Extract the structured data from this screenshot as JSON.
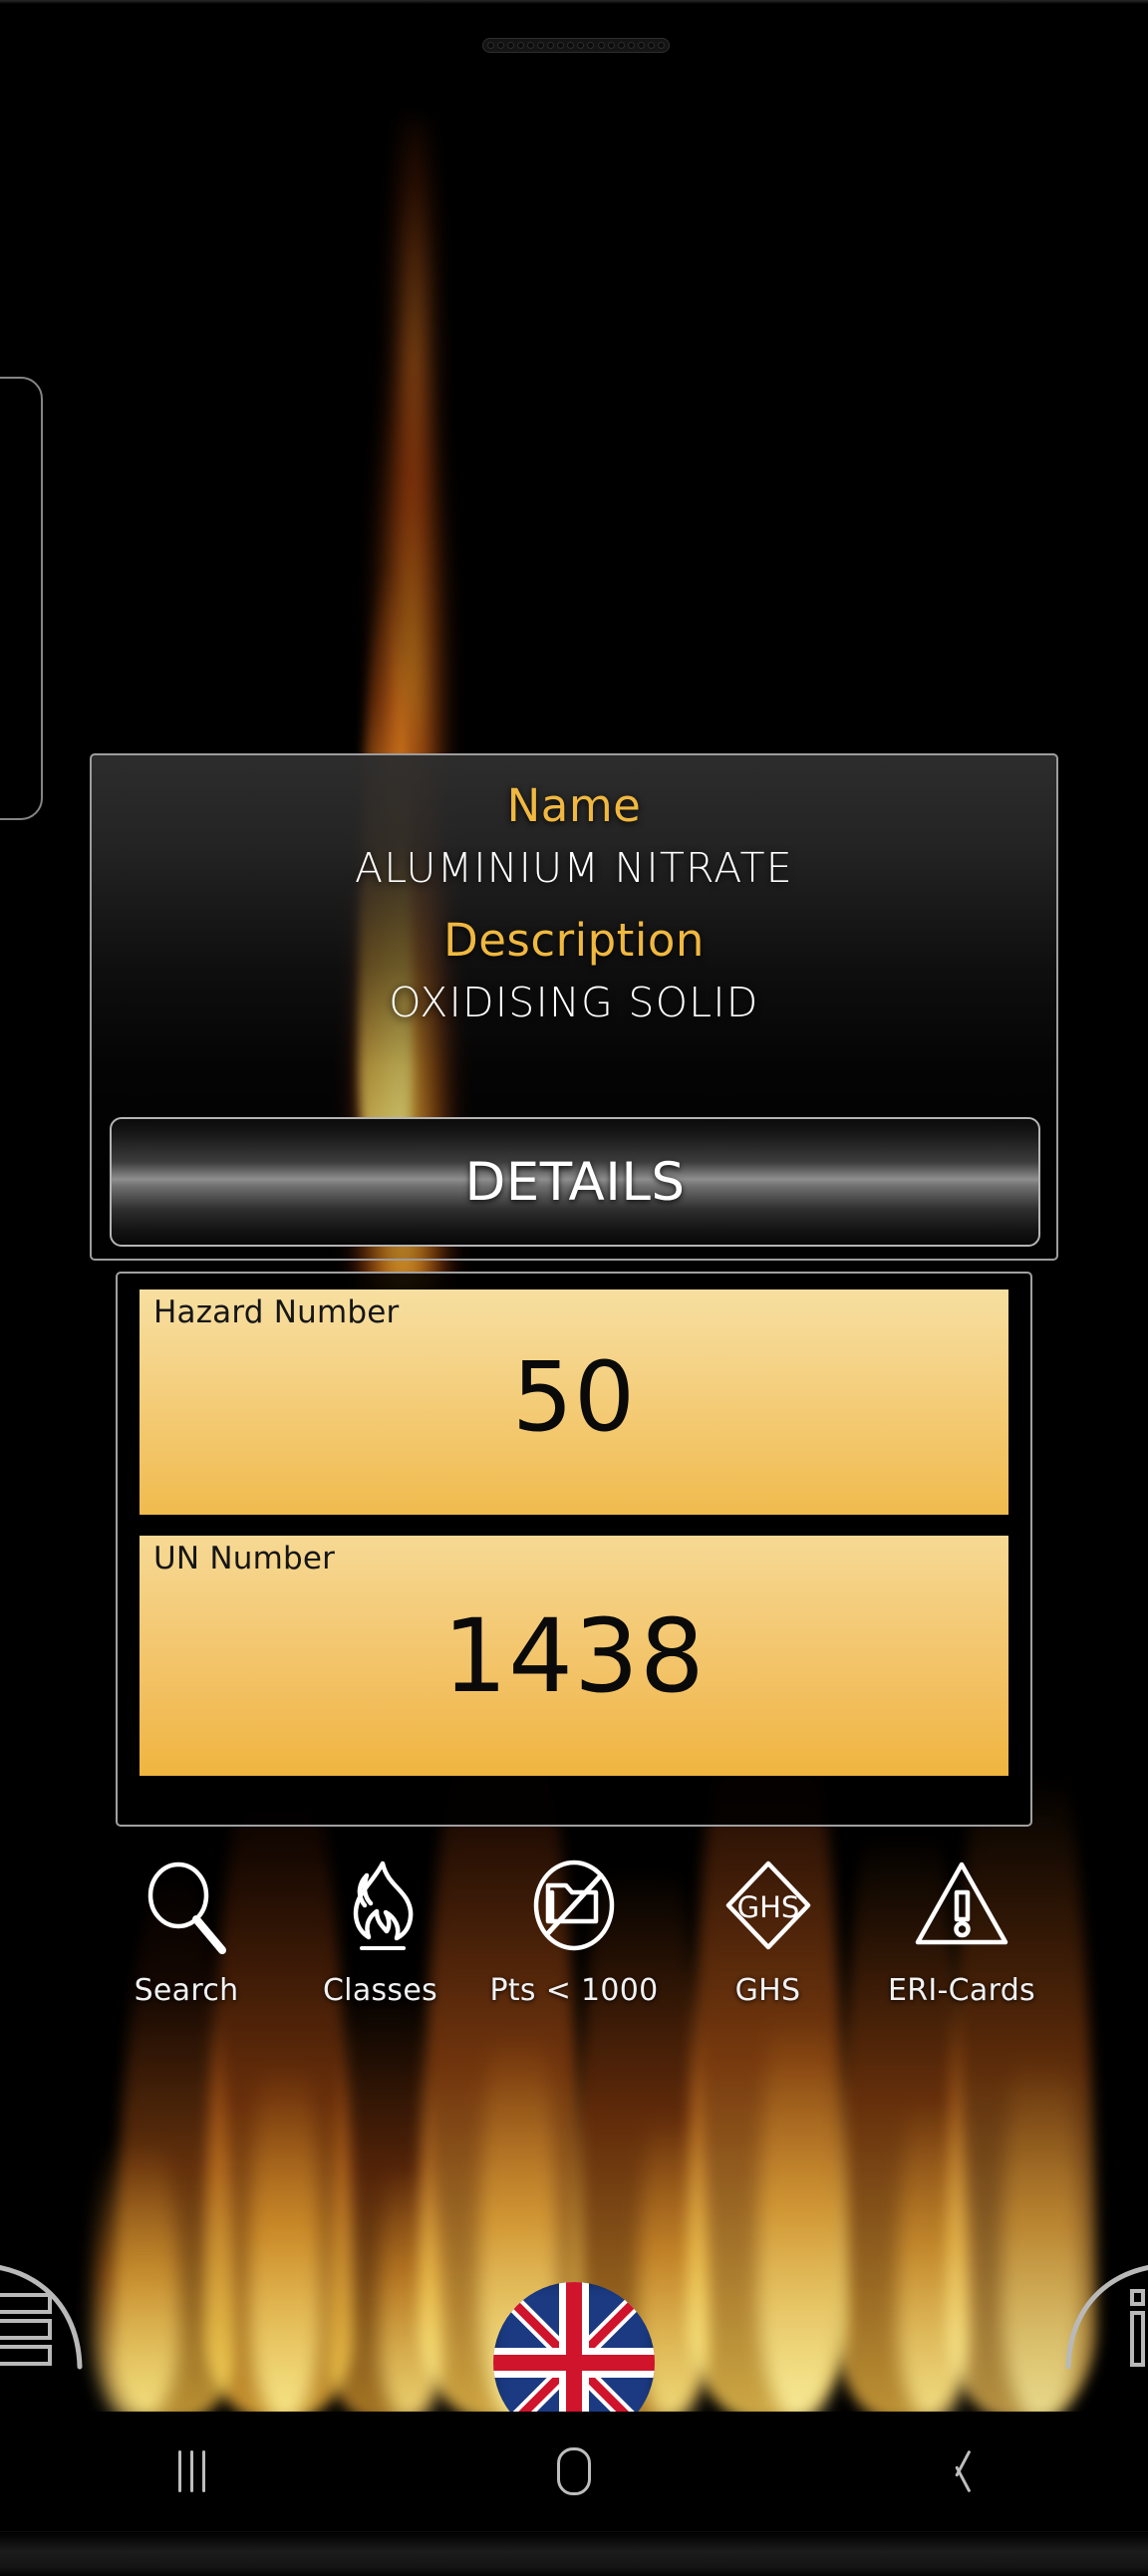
{
  "device": {
    "speaker_grille": "earpiece-speaker",
    "nav": {
      "recents_label": "|||",
      "home_label": "home",
      "back_label": "back"
    }
  },
  "info_card": {
    "name_label": "Name",
    "name_value": "ALUMINIUM NITRATE",
    "description_label": "Description",
    "description_value": "OXIDISING SOLID",
    "details_button": "DETAILS"
  },
  "numbers": {
    "hazard": {
      "caption": "Hazard Number",
      "value": "50"
    },
    "un": {
      "caption": "UN Number",
      "value": "1438"
    }
  },
  "toolbar": {
    "items": [
      {
        "icon": "search-icon",
        "label": "Search"
      },
      {
        "icon": "flame-icon",
        "label": "Classes"
      },
      {
        "icon": "no-folder-icon",
        "label": "Pts < 1000"
      },
      {
        "icon": "ghs-diamond-icon",
        "label": "GHS"
      },
      {
        "icon": "warning-triangle-icon",
        "label": "ERI-Cards"
      }
    ]
  },
  "bottom_actions": {
    "menu": "menu-button",
    "language": "uk-flag-language-button",
    "info": "info-button"
  },
  "colors": {
    "accent_gold": "#f0b83f",
    "panel_yellow_top": "#f7dfa0",
    "panel_yellow_bottom": "#f0b53f",
    "text_white": "#ffffff",
    "background": "#000000",
    "border_gray": "#9d9d9d"
  }
}
